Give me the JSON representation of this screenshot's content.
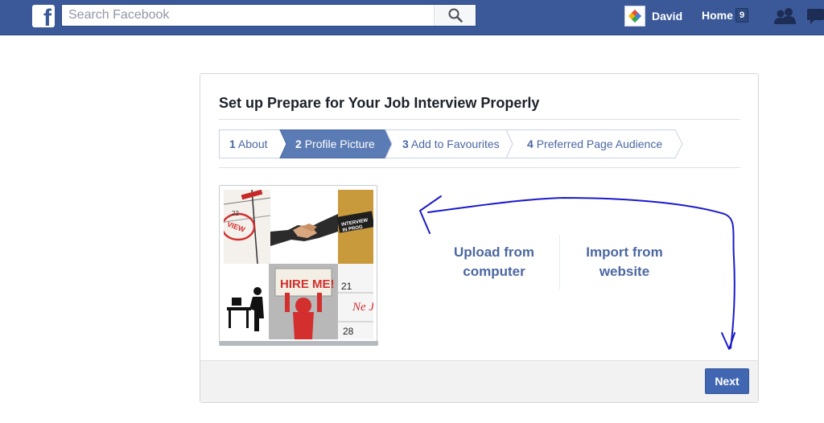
{
  "topbar": {
    "logo_letter": "f",
    "search_placeholder": "Search Facebook",
    "profile_name": "David",
    "home_label": "Home",
    "home_count": "9"
  },
  "setup": {
    "title": "Set up Prepare for Your Job Interview Properly",
    "steps": [
      {
        "num": "1",
        "label": "About",
        "active": false
      },
      {
        "num": "2",
        "label": "Profile Picture",
        "active": true
      },
      {
        "num": "3",
        "label": "Add to Favourites",
        "active": false
      },
      {
        "num": "4",
        "label": "Preferred Page Audience",
        "active": false
      }
    ],
    "upload_label": "Upload from computer",
    "import_label": "Import from website",
    "next_label": "Next"
  },
  "picture": {
    "hire_sign": "HIRE ME!",
    "calendar_numbers": [
      "21",
      "28"
    ],
    "calendar_text": "Ne Jo",
    "interview_tag": "INTERVIEW IN PROG"
  },
  "colors": {
    "brand": "#3b5998",
    "step_active": "#5b7bb5",
    "link": "#4b67a1",
    "annotation_ink": "#1a1acc"
  }
}
